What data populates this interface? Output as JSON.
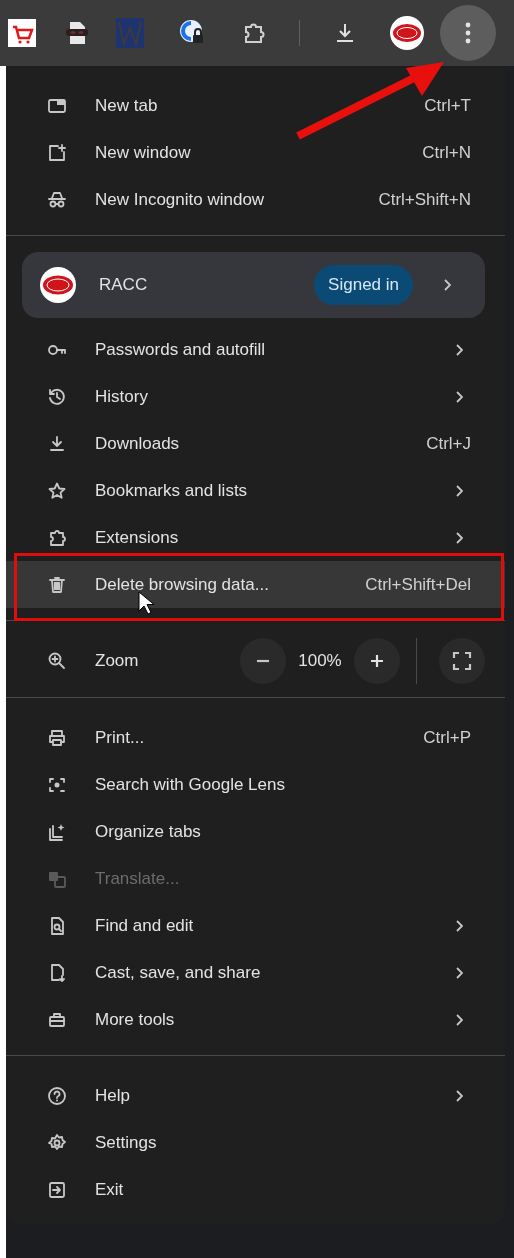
{
  "toolbar": {
    "menu_button": {
      "callout": true
    }
  },
  "menu": [
    {
      "kind": "item",
      "label": "New tab",
      "shortcut": "Ctrl+T",
      "submenu": false,
      "disabled": false,
      "hovered": false,
      "outlined": false
    },
    {
      "kind": "item",
      "label": "New window",
      "shortcut": "Ctrl+N",
      "submenu": false,
      "disabled": false,
      "hovered": false,
      "outlined": false
    },
    {
      "kind": "item",
      "label": "New Incognito window",
      "shortcut": "Ctrl+Shift+N",
      "submenu": false,
      "disabled": false,
      "hovered": false,
      "outlined": false
    },
    {
      "kind": "divider"
    },
    {
      "kind": "profile",
      "name": "RACC",
      "badge": "Signed in",
      "submenu": true
    },
    {
      "kind": "item",
      "label": "Passwords and autofill",
      "submenu": true,
      "disabled": false,
      "hovered": false,
      "outlined": false
    },
    {
      "kind": "item",
      "label": "History",
      "submenu": true,
      "disabled": false,
      "hovered": false,
      "outlined": false
    },
    {
      "kind": "item",
      "label": "Downloads",
      "shortcut": "Ctrl+J",
      "submenu": false,
      "disabled": false,
      "hovered": false,
      "outlined": false
    },
    {
      "kind": "item",
      "label": "Bookmarks and lists",
      "submenu": true,
      "disabled": false,
      "hovered": false,
      "outlined": false
    },
    {
      "kind": "item",
      "label": "Extensions",
      "submenu": true,
      "disabled": false,
      "hovered": false,
      "outlined": false
    },
    {
      "kind": "item",
      "label": "Delete browsing data...",
      "shortcut": "Ctrl+Shift+Del",
      "submenu": false,
      "disabled": false,
      "hovered": true,
      "outlined": true
    },
    {
      "kind": "divider"
    },
    {
      "kind": "zoom",
      "label": "Zoom",
      "value": "100%"
    },
    {
      "kind": "divider"
    },
    {
      "kind": "item",
      "label": "Print...",
      "shortcut": "Ctrl+P",
      "submenu": false,
      "disabled": false,
      "hovered": false,
      "outlined": false
    },
    {
      "kind": "item",
      "label": "Search with Google Lens",
      "submenu": false,
      "disabled": false,
      "hovered": false,
      "outlined": false
    },
    {
      "kind": "item",
      "label": "Organize tabs",
      "submenu": false,
      "disabled": false,
      "hovered": false,
      "outlined": false
    },
    {
      "kind": "item",
      "label": "Translate...",
      "submenu": false,
      "disabled": true,
      "hovered": false,
      "outlined": false
    },
    {
      "kind": "item",
      "label": "Find and edit",
      "submenu": true,
      "disabled": false,
      "hovered": false,
      "outlined": false
    },
    {
      "kind": "item",
      "label": "Cast, save, and share",
      "submenu": true,
      "disabled": false,
      "hovered": false,
      "outlined": false
    },
    {
      "kind": "item",
      "label": "More tools",
      "submenu": true,
      "disabled": false,
      "hovered": false,
      "outlined": false
    },
    {
      "kind": "divider"
    },
    {
      "kind": "item",
      "label": "Help",
      "submenu": true,
      "disabled": false,
      "hovered": false,
      "outlined": false
    },
    {
      "kind": "item",
      "label": "Settings",
      "submenu": false,
      "disabled": false,
      "hovered": false,
      "outlined": false
    },
    {
      "kind": "item",
      "label": "Exit",
      "submenu": false,
      "disabled": false,
      "hovered": false,
      "outlined": false
    }
  ]
}
